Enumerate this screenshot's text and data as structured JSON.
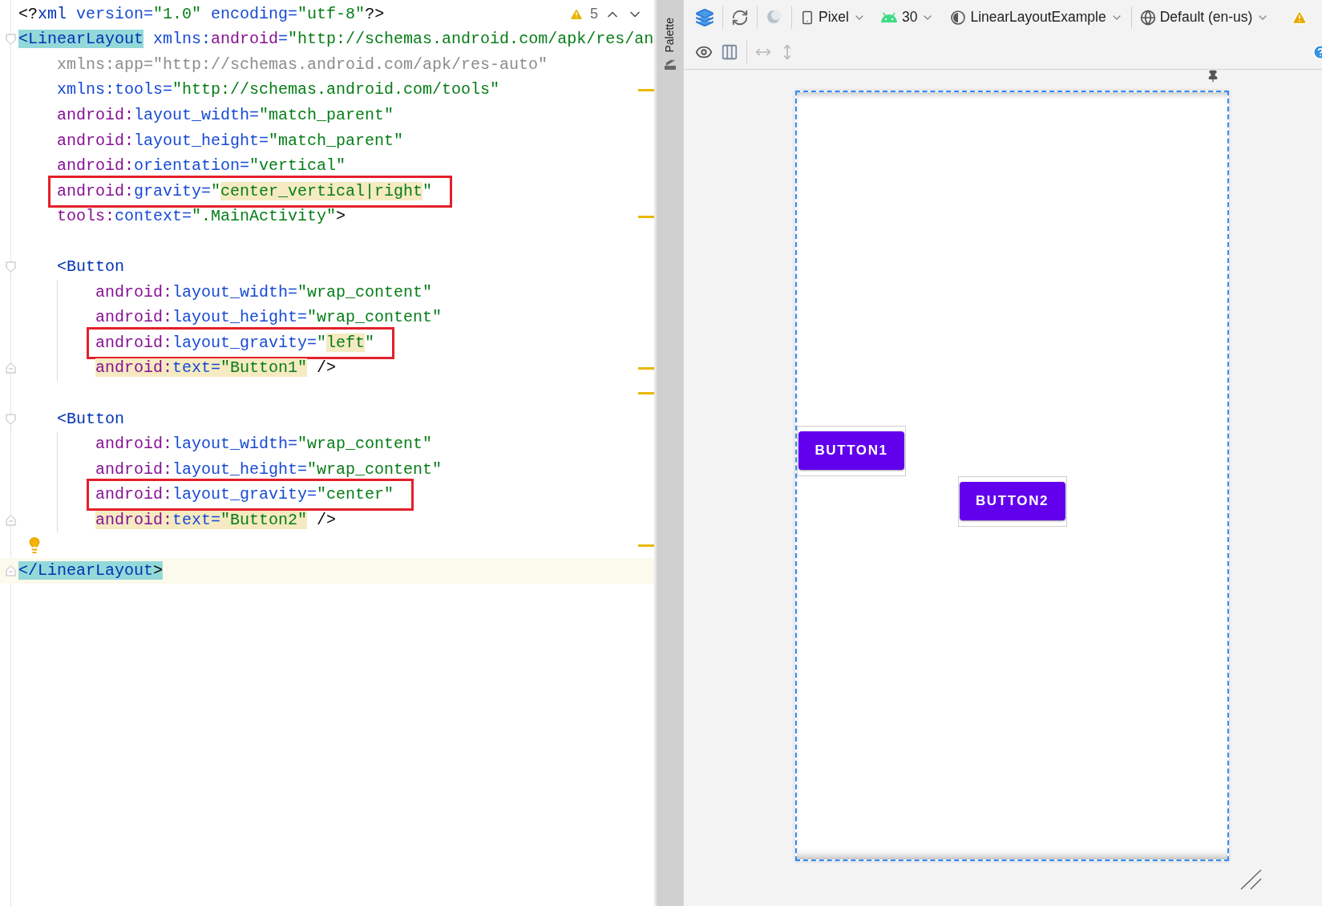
{
  "editor": {
    "warnings": "5",
    "lines": [
      {
        "kind": "root",
        "boxed": false,
        "marker": false,
        "current": false,
        "tokens": [
          {
            "kind": "punct",
            "t": "<?"
          },
          {
            "kind": "tag",
            "t": "xml"
          },
          {
            "kind": "attr",
            "t": " version="
          },
          {
            "kind": "value",
            "t": "\"1.0\""
          },
          {
            "kind": "attr",
            "t": " encoding="
          },
          {
            "kind": "value",
            "t": "\"utf-8\""
          },
          {
            "kind": "punct",
            "t": "?>"
          }
        ]
      },
      {
        "kind": "root",
        "boxed": false,
        "marker": false,
        "current": false,
        "gutter": {
          "kind": "fold-open"
        },
        "tokens": [
          {
            "kind": "tag-match",
            "t": "<LinearLayout"
          },
          {
            "kind": "attr",
            "t": " xmlns:"
          },
          {
            "kind": "ns",
            "t": "android"
          },
          {
            "kind": "attr",
            "t": "="
          },
          {
            "kind": "value",
            "t": "\"http://schemas.android.com/apk/res/an"
          }
        ]
      },
      {
        "kind": "root-attr",
        "boxed": false,
        "marker": false,
        "current": false,
        "tokens": [
          {
            "kind": "unused",
            "t": "xmlns:app=\"http://schemas.android.com/apk/res-auto\""
          }
        ]
      },
      {
        "kind": "root-attr",
        "boxed": false,
        "marker": true,
        "current": false,
        "tokens": [
          {
            "kind": "attr",
            "t": "xmlns:tools="
          },
          {
            "kind": "value",
            "t": "\"http://schemas.android.com/tools\""
          }
        ]
      },
      {
        "kind": "root-attr",
        "boxed": false,
        "marker": false,
        "current": false,
        "tokens": [
          {
            "kind": "ns",
            "t": "android:"
          },
          {
            "kind": "attr",
            "t": "layout_width="
          },
          {
            "kind": "value",
            "t": "\"match_parent\""
          }
        ]
      },
      {
        "kind": "root-attr",
        "boxed": false,
        "marker": false,
        "current": false,
        "tokens": [
          {
            "kind": "ns",
            "t": "android:"
          },
          {
            "kind": "attr",
            "t": "layout_height="
          },
          {
            "kind": "value",
            "t": "\"match_parent\""
          }
        ]
      },
      {
        "kind": "root-attr",
        "boxed": false,
        "marker": false,
        "current": false,
        "tokens": [
          {
            "kind": "ns",
            "t": "android:"
          },
          {
            "kind": "attr",
            "t": "orientation="
          },
          {
            "kind": "value",
            "t": "\"vertical\""
          }
        ]
      },
      {
        "kind": "root-attr",
        "boxed": true,
        "marker": false,
        "current": false,
        "tokens": [
          {
            "kind": "ns",
            "t": "android:"
          },
          {
            "kind": "attr",
            "t": "gravity="
          },
          {
            "kind": "value",
            "t": "\""
          },
          {
            "kind": "value-warn",
            "t": "center_vertical|right"
          },
          {
            "kind": "value",
            "t": "\""
          }
        ]
      },
      {
        "kind": "root-attr",
        "boxed": false,
        "marker": true,
        "current": false,
        "tokens": [
          {
            "kind": "ns",
            "t": "tools:"
          },
          {
            "kind": "attr",
            "t": "context="
          },
          {
            "kind": "value",
            "t": "\".MainActivity\""
          },
          {
            "kind": "punct",
            "t": ">"
          }
        ]
      },
      {
        "marker": false,
        "current": false
      },
      {
        "kind": "child",
        "boxed": false,
        "marker": false,
        "current": false,
        "gutter": {
          "kind": "fold-open"
        },
        "tokens": [
          {
            "kind": "tag",
            "t": "<Button"
          }
        ]
      },
      {
        "kind": "child-attr",
        "boxed": false,
        "marker": false,
        "current": false,
        "tokens": [
          {
            "kind": "ns",
            "t": "android:"
          },
          {
            "kind": "attr",
            "t": "layout_width="
          },
          {
            "kind": "value",
            "t": "\"wrap_content\""
          }
        ]
      },
      {
        "kind": "child-attr",
        "boxed": false,
        "marker": false,
        "current": false,
        "tokens": [
          {
            "kind": "ns",
            "t": "android:"
          },
          {
            "kind": "attr",
            "t": "layout_height="
          },
          {
            "kind": "value",
            "t": "\"wrap_content\""
          }
        ]
      },
      {
        "kind": "child-attr",
        "boxed": true,
        "marker": false,
        "current": false,
        "tokens": [
          {
            "kind": "ns",
            "t": "android:"
          },
          {
            "kind": "attr",
            "t": "layout_gravity="
          },
          {
            "kind": "value",
            "t": "\""
          },
          {
            "kind": "value-warn",
            "t": "left"
          },
          {
            "kind": "value",
            "t": "\""
          }
        ]
      },
      {
        "kind": "child-attr",
        "boxed": false,
        "marker": true,
        "current": false,
        "gutter": {
          "kind": "fold-close"
        },
        "tokens": [
          {
            "kind": "ns-warn",
            "t": "android:"
          },
          {
            "kind": "attr-warn",
            "t": "text="
          },
          {
            "kind": "value-warn",
            "t": "\"Button1\""
          },
          {
            "kind": "punct",
            "t": " />"
          }
        ]
      },
      {
        "marker": true,
        "current": false
      },
      {
        "kind": "child",
        "boxed": false,
        "marker": false,
        "current": false,
        "gutter": {
          "kind": "fold-open"
        },
        "tokens": [
          {
            "kind": "tag",
            "t": "<Button"
          }
        ]
      },
      {
        "kind": "child-attr",
        "boxed": false,
        "marker": false,
        "current": false,
        "tokens": [
          {
            "kind": "ns",
            "t": "android:"
          },
          {
            "kind": "attr",
            "t": "layout_width="
          },
          {
            "kind": "value",
            "t": "\"wrap_content\""
          }
        ]
      },
      {
        "kind": "child-attr",
        "boxed": false,
        "marker": false,
        "current": false,
        "tokens": [
          {
            "kind": "ns",
            "t": "android:"
          },
          {
            "kind": "attr",
            "t": "layout_height="
          },
          {
            "kind": "value",
            "t": "\"wrap_content\""
          }
        ]
      },
      {
        "kind": "child-attr",
        "boxed": true,
        "marker": false,
        "current": false,
        "tokens": [
          {
            "kind": "ns",
            "t": "android:"
          },
          {
            "kind": "attr",
            "t": "layout_gravity="
          },
          {
            "kind": "value",
            "t": "\"center\""
          }
        ]
      },
      {
        "kind": "child-attr",
        "boxed": false,
        "marker": false,
        "current": false,
        "gutter": {
          "kind": "fold-close"
        },
        "tokens": [
          {
            "kind": "ns-warn",
            "t": "android:"
          },
          {
            "kind": "attr-warn",
            "t": "text="
          },
          {
            "kind": "value-warn",
            "t": "\"Button2\""
          },
          {
            "kind": "punct",
            "t": " />"
          }
        ]
      },
      {
        "marker": true,
        "current": false,
        "gutter": {
          "kind": "bulb"
        }
      },
      {
        "kind": "root",
        "boxed": false,
        "marker": false,
        "current": true,
        "gutter": {
          "kind": "fold-close"
        },
        "tokens": [
          {
            "kind": "tag-match",
            "t": "</LinearLayout"
          },
          {
            "kind": "punct-match",
            "t": ">"
          }
        ]
      }
    ]
  },
  "palette": {
    "label": "Palette"
  },
  "toolbar": {
    "device": "Pixel",
    "api": "30",
    "theme": "LinearLayoutExample",
    "locale": "Default (en-us)"
  },
  "preview": {
    "buttons": [
      {
        "label": "BUTTON1",
        "kind": "left"
      },
      {
        "label": "BUTTON2",
        "kind": "center"
      }
    ]
  }
}
